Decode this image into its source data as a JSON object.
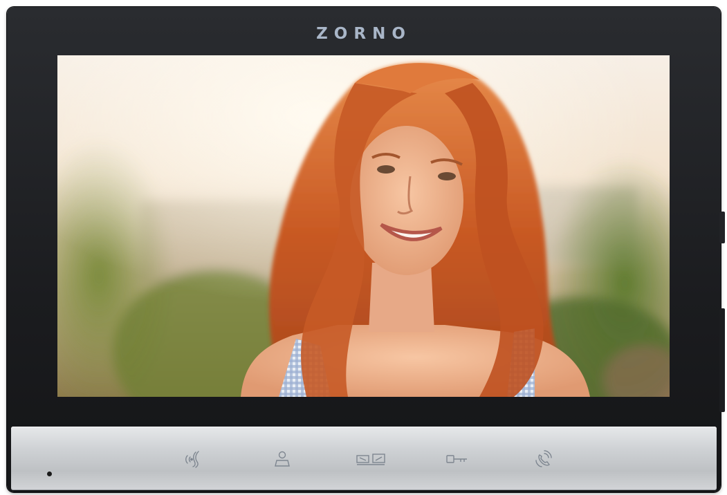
{
  "device": {
    "brand": "ZORNO"
  },
  "screen": {
    "content": "live-camera-view"
  },
  "buttons": [
    {
      "name": "talk-button",
      "icon": "speaker-wave-icon"
    },
    {
      "name": "monitor-button",
      "icon": "person-icon"
    },
    {
      "name": "gate-button",
      "icon": "gate-icon"
    },
    {
      "name": "unlock-button",
      "icon": "key-icon"
    },
    {
      "name": "call-button",
      "icon": "phone-ring-icon"
    }
  ],
  "colors": {
    "frame": "#1b1c1f",
    "panel": "#cfd2d5",
    "icons": "#7e8690",
    "brand": "#a9b6c8"
  }
}
